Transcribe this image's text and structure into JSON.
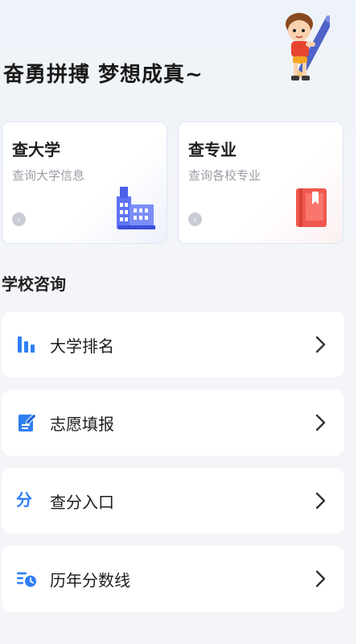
{
  "header": {
    "slogan": "奋勇拼搏  梦想成真~"
  },
  "quick_cards": [
    {
      "title": "查大学",
      "subtitle": "查询大学信息",
      "icon": "school-building-icon",
      "accent": "#4b63f2"
    },
    {
      "title": "查专业",
      "subtitle": "查询各校专业",
      "icon": "book-icon",
      "accent": "#f0584e"
    }
  ],
  "section": {
    "title": "学校咨询"
  },
  "menu": [
    {
      "label": "大学排名",
      "icon": "bar-chart-icon"
    },
    {
      "label": "志愿填报",
      "icon": "edit-form-icon"
    },
    {
      "label": "查分入口",
      "icon": "fen-score-icon",
      "icon_text": "分"
    },
    {
      "label": "历年分数线",
      "icon": "history-list-icon"
    }
  ],
  "colors": {
    "icon_blue": "#2f7ff5",
    "chevron": "#333333"
  }
}
